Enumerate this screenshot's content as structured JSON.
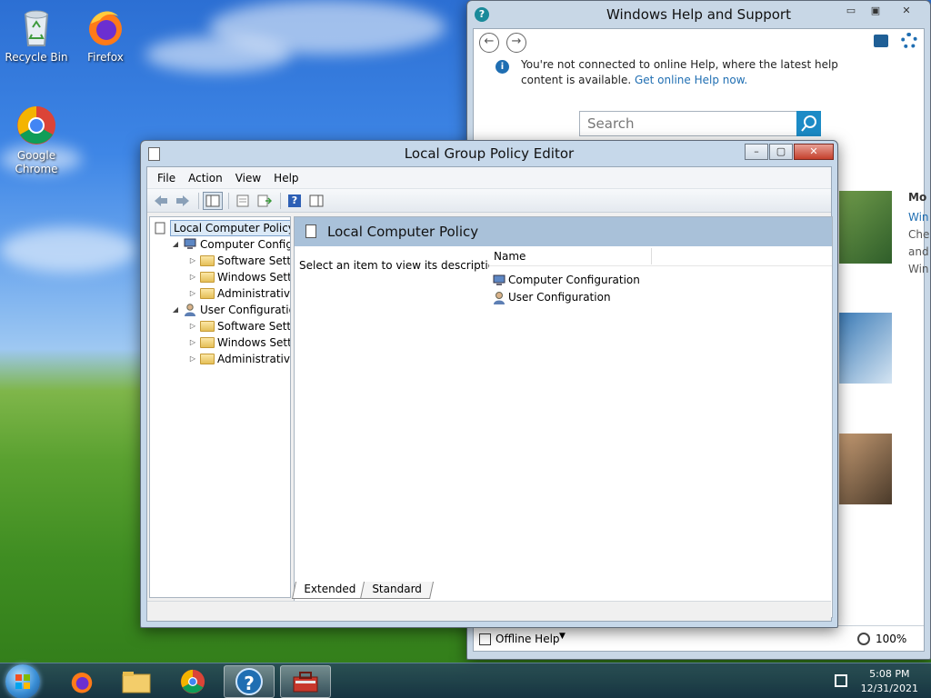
{
  "desktop": {
    "icons": [
      {
        "label": "Recycle Bin"
      },
      {
        "label": "Firefox"
      },
      {
        "label": "Google Chrome"
      }
    ]
  },
  "help_window": {
    "title": "Windows Help and Support",
    "notice_text": "You're not connected to online Help, where the latest help content is available.",
    "notice_link": "Get online Help now.",
    "search_placeholder": "Search",
    "side_texts": [
      "Mo",
      "Win",
      "Che",
      "and",
      "Win"
    ],
    "offline_label": "Offline Help",
    "zoom": "100%"
  },
  "gp_window": {
    "title": "Local Group Policy Editor",
    "menu": [
      "File",
      "Action",
      "View",
      "Help"
    ],
    "tree": [
      {
        "label": "Local Computer Policy",
        "level": 0,
        "expander": "",
        "icon": "policy-icon",
        "selected": true
      },
      {
        "label": "Computer Configura",
        "level": 1,
        "expander": "◢",
        "icon": "computer-icon"
      },
      {
        "label": "Software Settings",
        "level": 2,
        "expander": "▷",
        "icon": "folder-icon"
      },
      {
        "label": "Windows Setting",
        "level": 2,
        "expander": "▷",
        "icon": "folder-icon"
      },
      {
        "label": "Administrative Te",
        "level": 2,
        "expander": "▷",
        "icon": "folder-icon"
      },
      {
        "label": "User Configuration",
        "level": 1,
        "expander": "◢",
        "icon": "user-icon"
      },
      {
        "label": "Software Settings",
        "level": 2,
        "expander": "▷",
        "icon": "folder-icon"
      },
      {
        "label": "Windows Setting",
        "level": 2,
        "expander": "▷",
        "icon": "folder-icon"
      },
      {
        "label": "Administrative Te",
        "level": 2,
        "expander": "▷",
        "icon": "folder-icon"
      }
    ],
    "pane_title": "Local Computer Policy",
    "description": "Select an item to view its description.",
    "column_name": "Name",
    "items": [
      "Computer Configuration",
      "User Configuration"
    ],
    "tabs": [
      "Extended",
      "Standard"
    ]
  },
  "taskbar": {
    "time": "5:08 PM",
    "date": "12/31/2021"
  }
}
